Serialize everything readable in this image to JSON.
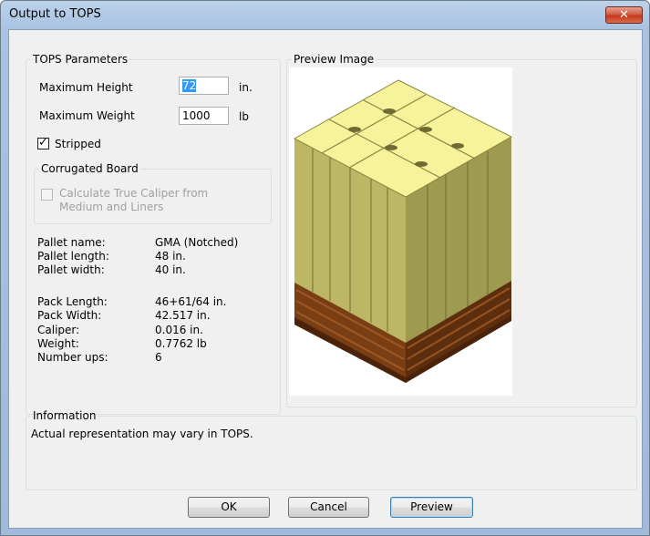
{
  "window": {
    "title": "Output to TOPS",
    "close_glyph": "✕"
  },
  "tops_parameters": {
    "legend": "TOPS Parameters",
    "max_height_label": "Maximum Height",
    "max_height_value": "72",
    "max_height_unit": "in.",
    "max_weight_label": "Maximum Weight",
    "max_weight_value": "1000",
    "max_weight_unit": "lb",
    "stripped_label": "Stripped",
    "stripped_checked": true
  },
  "corrugated_board": {
    "legend": "Corrugated Board",
    "calc_line1": "Calculate True Caliper from",
    "calc_line2": "Medium and Liners",
    "calc_checked": false
  },
  "pallet_info": [
    {
      "label": "Pallet name:",
      "value": "GMA (Notched)"
    },
    {
      "label": "Pallet length:",
      "value": "48 in."
    },
    {
      "label": "Pallet width:",
      "value": "40 in."
    }
  ],
  "pack_info": [
    {
      "label": "Pack Length:",
      "value": "46+61/64 in."
    },
    {
      "label": "Pack Width:",
      "value": "42.517 in."
    },
    {
      "label": "Caliper:",
      "value": "0.016 in."
    },
    {
      "label": "Weight:",
      "value": "0.7762 lb"
    },
    {
      "label": "Number ups:",
      "value": "6"
    }
  ],
  "preview": {
    "legend": "Preview Image"
  },
  "information": {
    "legend": "Information",
    "text": "Actual representation may vary in TOPS."
  },
  "buttons": {
    "ok": "OK",
    "cancel": "Cancel",
    "preview": "Preview"
  },
  "colors": {
    "box_top": "#f5f294",
    "box_side": "#c8c36c",
    "pallet": "#8c4a1c",
    "selection": "#3399ff"
  }
}
